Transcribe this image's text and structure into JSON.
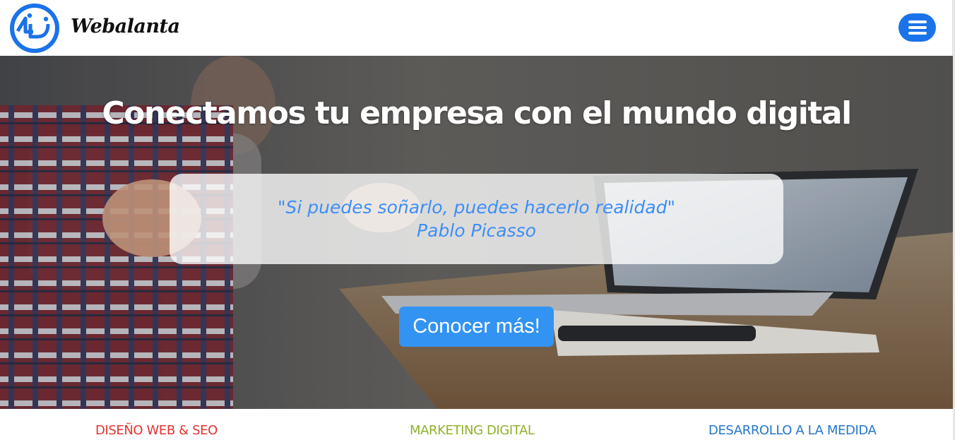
{
  "header": {
    "brand": "Webalanta",
    "logo_icon": "wd-monogram-logo-icon",
    "menu_icon": "hamburger-menu-icon"
  },
  "hero": {
    "title": "Conectamos tu empresa con el mundo digital",
    "quote": "\"Si puedes soñarlo, puedes hacerlo realidad\"",
    "quote_author": "Pablo Picasso",
    "cta_label": "Conocer más!"
  },
  "services": [
    {
      "label": "DISEÑO WEB & SEO",
      "color": "#e53232"
    },
    {
      "label": "MARKETING DIGITAL",
      "color": "#8db32b"
    },
    {
      "label": "DESARROLLO A LA MEDIDA",
      "color": "#2577c9"
    }
  ],
  "colors": {
    "brand_blue": "#1a73e8",
    "cta_blue": "#3393f2",
    "quote_blue": "#3d8ef5"
  }
}
